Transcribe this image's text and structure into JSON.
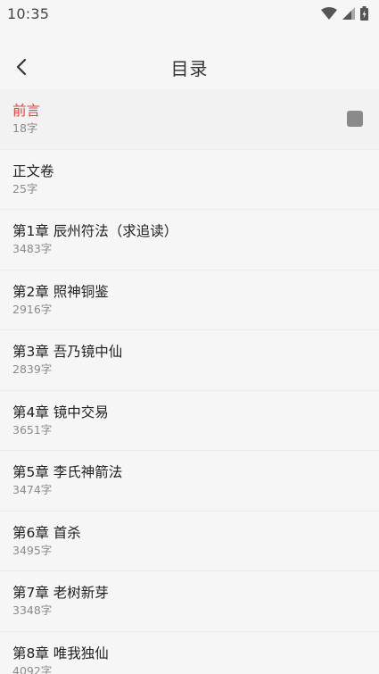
{
  "status": {
    "time": "10:35"
  },
  "header": {
    "title": "目录"
  },
  "chapters": [
    {
      "title": "前言",
      "count": "18字"
    },
    {
      "title": "正文卷",
      "count": "25字"
    },
    {
      "title": "第1章 辰州符法（求追读）",
      "count": "3483字"
    },
    {
      "title": "第2章 照神铜鉴",
      "count": "2916字"
    },
    {
      "title": "第3章 吾乃镜中仙",
      "count": "2839字"
    },
    {
      "title": "第4章 镜中交易",
      "count": "3651字"
    },
    {
      "title": "第5章 李氏神箭法",
      "count": "3474字"
    },
    {
      "title": "第6章 首杀",
      "count": "3495字"
    },
    {
      "title": "第7章 老树新芽",
      "count": "3348字"
    },
    {
      "title": "第8章 唯我独仙",
      "count": "4092字"
    }
  ],
  "colors": {
    "accent": "#e0453a",
    "background": "#f6f6f6"
  }
}
